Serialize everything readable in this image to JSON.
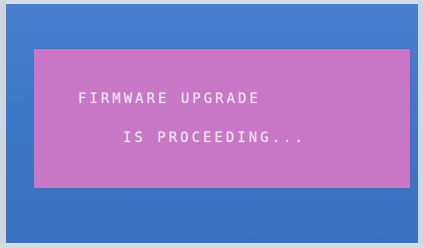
{
  "dialog": {
    "line1": "FIRMWARE UPGRADE",
    "line2": "IS PROCEEDING..."
  },
  "colors": {
    "screen_background": "#3f78c8",
    "dialog_background": "#c877c6",
    "text": "#f3e4f3"
  }
}
